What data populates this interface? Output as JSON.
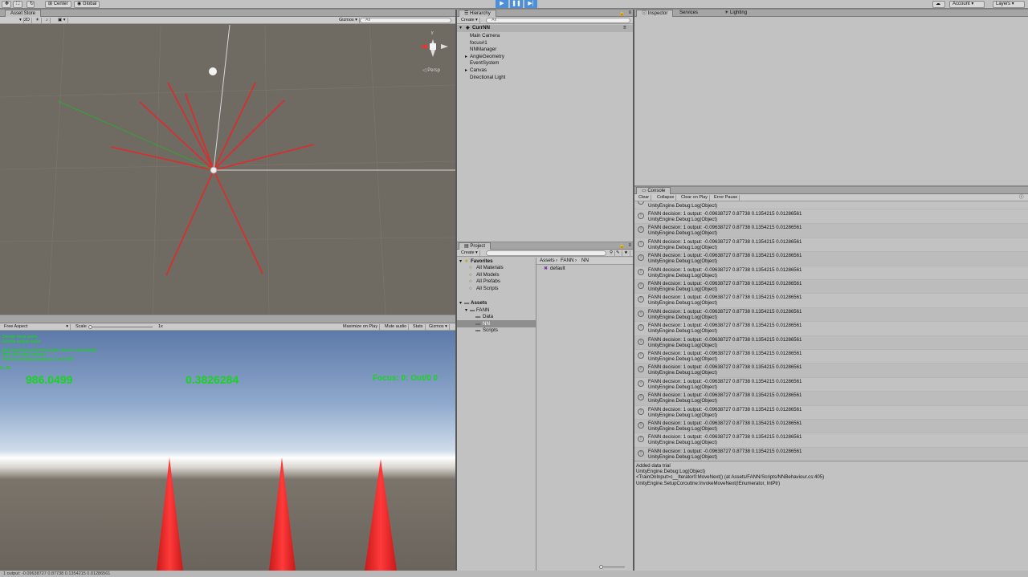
{
  "toolbar": {
    "center_label": "Center",
    "global_label": "Global",
    "account_label": "Account",
    "layers_label": "Layers"
  },
  "scene": {
    "tab": "Asset Store",
    "mode_2d": "2D",
    "gizmos": "Gizmos",
    "search_placeholder": "All",
    "persp_label": "Persp",
    "gizmo_y": "y",
    "gizmo_x": "x"
  },
  "game": {
    "aspect": "Free Aspect",
    "scale_label": "Scale",
    "scale_value": "1x",
    "maximize": "Maximize on Play",
    "mute": "Mute audio",
    "stats": "Stats",
    "gizmos": "Gizmos",
    "hud_lines": [
      "- Decide focal point",
      "- Decide output value",
      "",
      "- Add new line of current angle, focus#, and output",
      "- Save this data instance",
      "- Train on all data instances & save NN",
      "",
      "ts: 62"
    ],
    "value_left": "986.0499",
    "value_mid": "0.3826284",
    "focus_text": "Focus: 0: Out/0 0"
  },
  "hierarchy": {
    "tab": "Hierarchy",
    "create": "Create",
    "search_placeholder": "All",
    "scene_name": "CurrNN",
    "items": [
      {
        "label": "Main Camera",
        "indent": 1,
        "expandable": false
      },
      {
        "label": "focus#1",
        "indent": 1,
        "expandable": false
      },
      {
        "label": "NNManager",
        "indent": 1,
        "expandable": false
      },
      {
        "label": "AngleGeometry",
        "indent": 1,
        "expandable": true
      },
      {
        "label": "EventSystem",
        "indent": 1,
        "expandable": false
      },
      {
        "label": "Canvas",
        "indent": 1,
        "expandable": true
      },
      {
        "label": "Directional Light",
        "indent": 1,
        "expandable": false
      }
    ]
  },
  "project": {
    "tab": "Project",
    "create": "Create",
    "favorites_label": "Favorites",
    "favorites": [
      "All Materials",
      "All Models",
      "All Prefabs",
      "All Scripts"
    ],
    "assets_label": "Assets",
    "fann_label": "FANN",
    "fann_children": [
      "Data",
      "NN",
      "Scripts"
    ],
    "breadcrumb": [
      "Assets",
      "FANN",
      "NN"
    ],
    "file": "default"
  },
  "inspector": {
    "tabs": [
      "Inspector",
      "Services",
      "Lighting"
    ]
  },
  "console": {
    "tab": "Console",
    "buttons": [
      "Clear",
      "Collapse",
      "Clear on Play",
      "Error Pause"
    ],
    "first_line": "UnityEngine.Debug:Log(Object)",
    "entries": [
      {
        "line1": "FANN decision: 1 output: -0.09638727 0.87738 0.1354215 0.01286561",
        "line2": "UnityEngine.Debug:Log(Object)"
      },
      {
        "line1": "FANN decision: 1 output: -0.09638727 0.87738 0.1354215 0.01286561",
        "line2": "UnityEngine.Debug:Log(Object)"
      },
      {
        "line1": "FANN decision: 1 output: -0.09638727 0.87738 0.1354215 0.01286561",
        "line2": "UnityEngine.Debug:Log(Object)"
      },
      {
        "line1": "FANN decision: 1 output: -0.09638727 0.87738 0.1354215 0.01286561",
        "line2": "UnityEngine.Debug:Log(Object)"
      },
      {
        "line1": "FANN decision: 1 output: -0.09638727 0.87738 0.1354215 0.01286561",
        "line2": "UnityEngine.Debug:Log(Object)"
      },
      {
        "line1": "FANN decision: 1 output: -0.09638727 0.87738 0.1354215 0.01286561",
        "line2": "UnityEngine.Debug:Log(Object)"
      },
      {
        "line1": "FANN decision: 1 output: -0.09638727 0.87738 0.1354215 0.01286561",
        "line2": "UnityEngine.Debug:Log(Object)"
      },
      {
        "line1": "FANN decision: 1 output: -0.09638727 0.87738 0.1354215 0.01286561",
        "line2": "UnityEngine.Debug:Log(Object)"
      },
      {
        "line1": "FANN decision: 1 output: -0.09638727 0.87738 0.1354215 0.01286561",
        "line2": "UnityEngine.Debug:Log(Object)"
      },
      {
        "line1": "FANN decision: 1 output: -0.09638727 0.87738 0.1354215 0.01286561",
        "line2": "UnityEngine.Debug:Log(Object)"
      },
      {
        "line1": "FANN decision: 1 output: -0.09638727 0.87738 0.1354215 0.01286561",
        "line2": "UnityEngine.Debug:Log(Object)"
      },
      {
        "line1": "FANN decision: 1 output: -0.09638727 0.87738 0.1354215 0.01286561",
        "line2": "UnityEngine.Debug:Log(Object)"
      },
      {
        "line1": "FANN decision: 1 output: -0.09638727 0.87738 0.1354215 0.01286561",
        "line2": "UnityEngine.Debug:Log(Object)"
      },
      {
        "line1": "FANN decision: 1 output: -0.09638727 0.87738 0.1354215 0.01286561",
        "line2": "UnityEngine.Debug:Log(Object)"
      },
      {
        "line1": "FANN decision: 1 output: -0.09638727 0.87738 0.1354215 0.01286561",
        "line2": "UnityEngine.Debug:Log(Object)"
      },
      {
        "line1": "FANN decision: 1 output: -0.09638727 0.87738 0.1354215 0.01286561",
        "line2": "UnityEngine.Debug:Log(Object)"
      },
      {
        "line1": "FANN decision: 1 output: -0.09638727 0.87738 0.1354215 0.01286561",
        "line2": "UnityEngine.Debug:Log(Object)"
      },
      {
        "line1": "FANN decision: 1 output: -0.09638727 0.87738 0.1354215 0.01286561",
        "line2": "UnityEngine.Debug:Log(Object)"
      }
    ],
    "detail": [
      "Added data trial",
      "UnityEngine.Debug:Log(Object)",
      "<TrainOnInput>c__Iterator0:MoveNext() (at Assets/FANN/Scripts/NNBehaviour.cs:405)",
      "UnityEngine.SetupCoroutine:InvokeMoveNext(IEnumerator, IntPtr)"
    ]
  },
  "status_bar": "1 output: -0.09638727 0.87738 0.1354215 0.01286561",
  "colors": {
    "accent": "#4a8fd8",
    "hud_green": "#19d31e",
    "ray_red": "#e12a2a",
    "ray_green": "#2fa82f",
    "spike_red": "#f02a2a"
  }
}
